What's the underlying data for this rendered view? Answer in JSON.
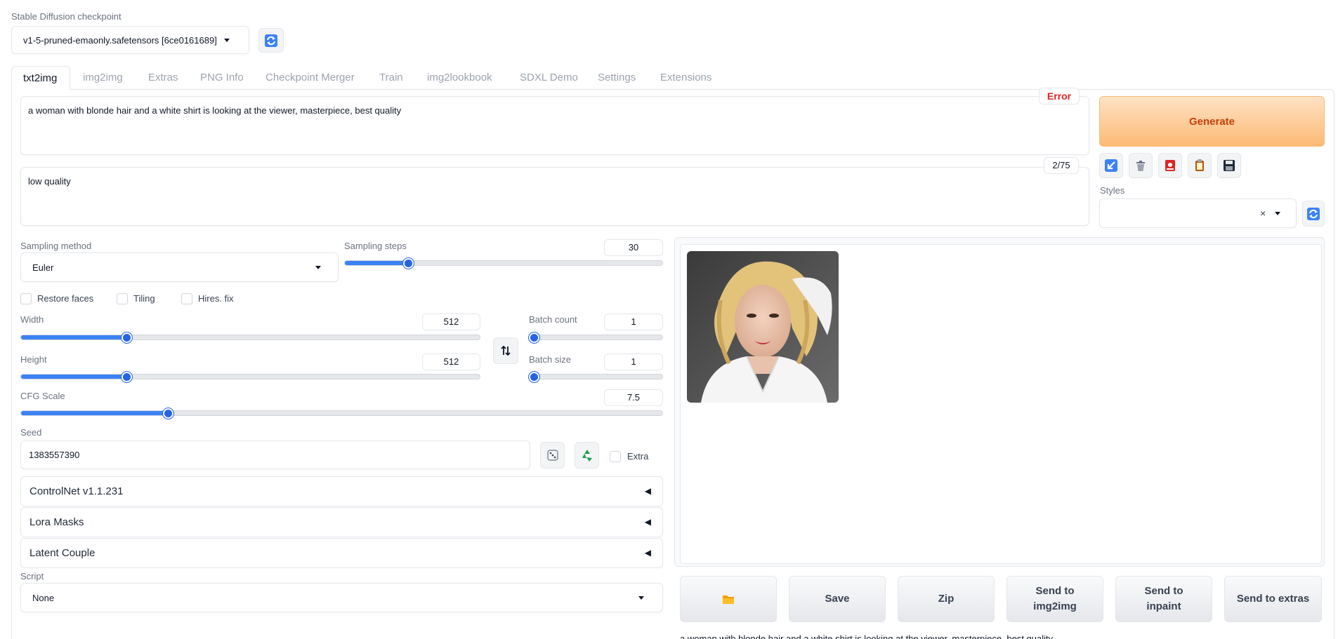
{
  "checkpoint": {
    "label": "Stable Diffusion checkpoint",
    "value": "v1-5-pruned-emaonly.safetensors [6ce0161689]",
    "refresh_icon": "refresh-icon"
  },
  "tabs": [
    "txt2img",
    "img2img",
    "Extras",
    "PNG Info",
    "Checkpoint Merger",
    "Train",
    "img2lookbook",
    "SDXL Demo",
    "Settings",
    "Extensions"
  ],
  "prompt": {
    "positive": "a woman with blonde hair and a white shirt is looking at the viewer, masterpiece, best quality",
    "negative": "low quality",
    "error_badge": "Error",
    "token_count": "2/75"
  },
  "generate": {
    "label": "Generate",
    "tools": [
      "arrow-icon",
      "trash-icon",
      "card-icon",
      "clipboard-icon",
      "save-icon"
    ]
  },
  "styles": {
    "label": "Styles",
    "clear": "×"
  },
  "sampling": {
    "method_label": "Sampling method",
    "method_value": "Euler",
    "steps_label": "Sampling steps",
    "steps_value": "30",
    "steps_fraction": 0.2
  },
  "options": {
    "restore_faces": "Restore faces",
    "tiling": "Tiling",
    "hires_fix": "Hires. fix"
  },
  "size": {
    "width_label": "Width",
    "width_value": "512",
    "width_fraction": 0.23,
    "height_label": "Height",
    "height_value": "512",
    "height_fraction": 0.23,
    "batch_count_label": "Batch count",
    "batch_count_value": "1",
    "batch_size_label": "Batch size",
    "batch_size_value": "1",
    "swap_icon": "swap-icon"
  },
  "cfg": {
    "label": "CFG Scale",
    "value": "7.5",
    "fraction": 0.23
  },
  "seed": {
    "label": "Seed",
    "value": "1383557390",
    "extra_label": "Extra",
    "dice_icon": "dice-icon",
    "recycle_icon": "recycle-icon"
  },
  "accordions": [
    "ControlNet v1.1.231",
    "Lora Masks",
    "Latent Couple"
  ],
  "script": {
    "label": "Script",
    "value": "None"
  },
  "output": {
    "folder_icon": "folder-icon",
    "buttons": [
      "Save",
      "Zip",
      "Send to img2img",
      "Send to inpaint",
      "Send to extras"
    ],
    "caption": "a woman with blonde hair and a white shirt is looking at the viewer, masterpiece, best quality"
  },
  "colors": {
    "accent": "#3b82f6",
    "generate_start": "#fed7aa",
    "generate_end": "#fdba74",
    "generate_text": "#c2410c",
    "error": "#dc2626"
  }
}
